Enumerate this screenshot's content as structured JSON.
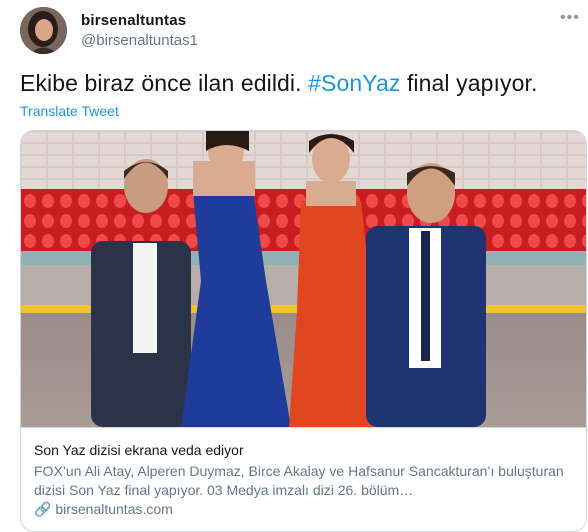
{
  "tweet": {
    "author": {
      "display_name": "birsenaltuntas",
      "handle": "@birsenaltuntas1",
      "avatar_icon": "user-avatar"
    },
    "text_before_hashtag": "Ekibe biraz önce ilan edildi. ",
    "hashtag": "#SonYaz",
    "text_after_hashtag": " final yapıyor.",
    "translate_label": "Translate Tweet",
    "more_icon": "ellipsis-icon"
  },
  "card": {
    "title": "Son Yaz dizisi ekrana veda ediyor",
    "description": "FOX’un Ali Atay, Alperen Duymaz, Birce Akalay ve Hafsanur Sancakturan’ı buluşturan dizisi Son Yaz final yapıyor. 03 Medya imzalı dizi 26. bölüm…",
    "domain": "🔗 birsenaltuntas.com"
  },
  "colors": {
    "link": "#1b95e0",
    "primary_text": "#14171a",
    "secondary_text": "#657786",
    "border": "#ccd6dd"
  }
}
